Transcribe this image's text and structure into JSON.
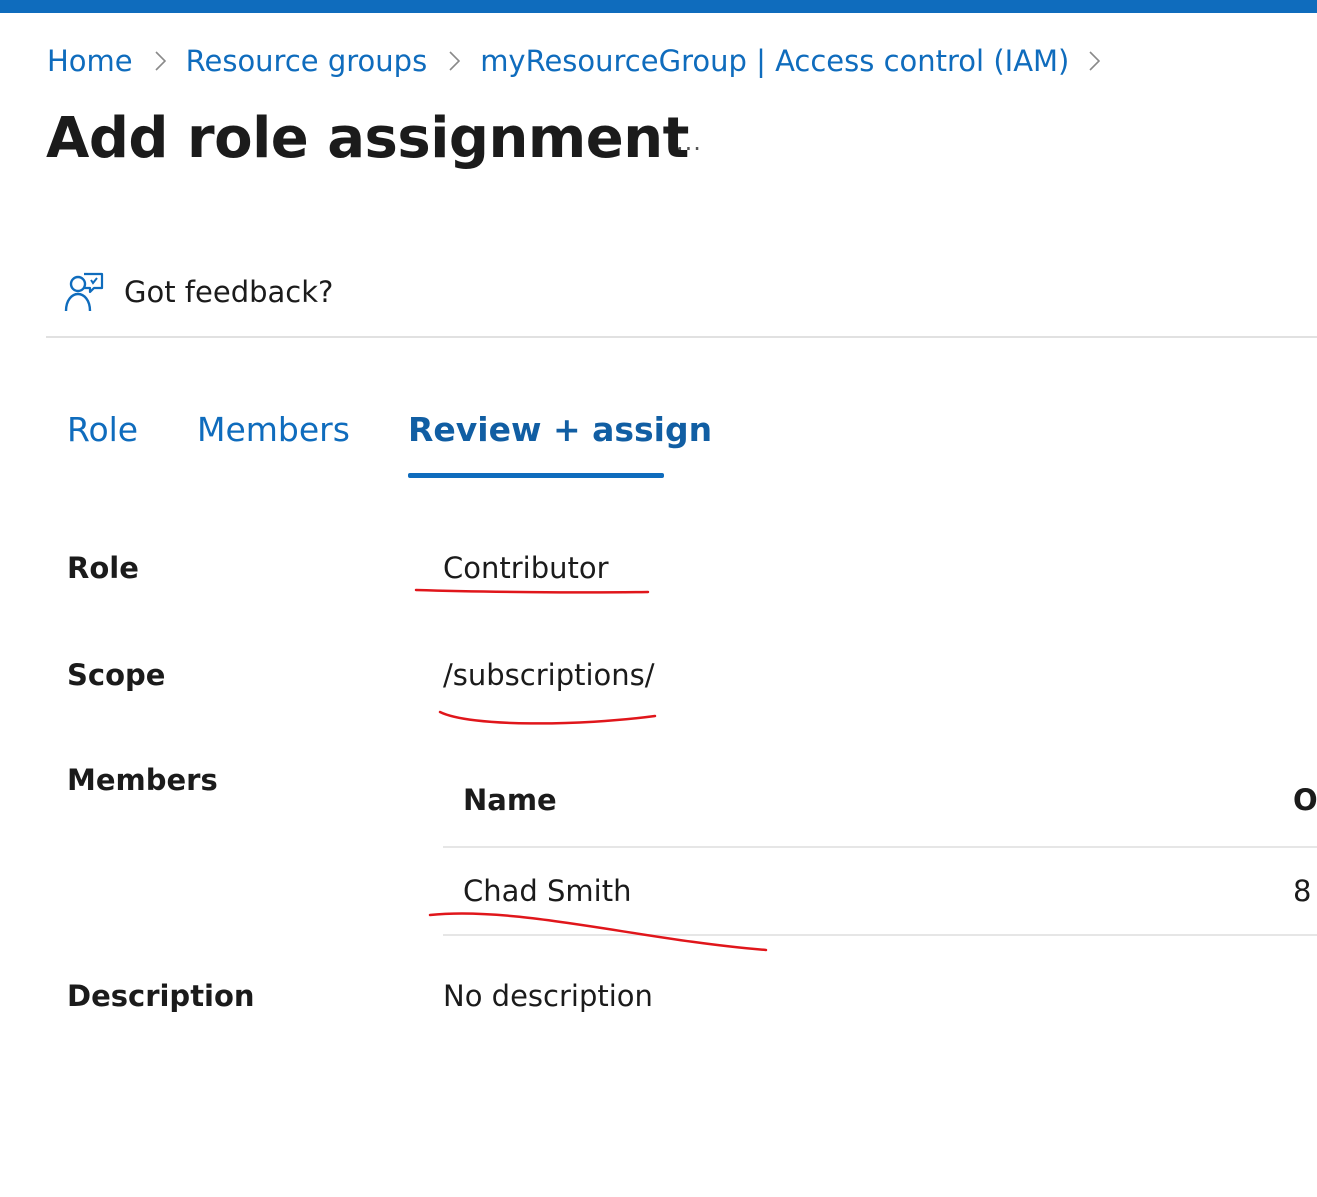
{
  "breadcrumb": {
    "items": [
      "Home",
      "Resource groups",
      "myResourceGroup | Access control (IAM)"
    ]
  },
  "page": {
    "title": "Add role assignment",
    "more_label": "..."
  },
  "toolbar": {
    "feedback_label": "Got feedback?"
  },
  "tabs": [
    {
      "label": "Role",
      "active": false
    },
    {
      "label": "Members",
      "active": false
    },
    {
      "label": "Review + assign",
      "active": true
    }
  ],
  "review": {
    "role_label": "Role",
    "role_value": "Contributor",
    "scope_label": "Scope",
    "scope_value": "/subscriptions/",
    "members_label": "Members",
    "members_table": {
      "columns": [
        "Name",
        "O"
      ],
      "rows": [
        [
          "Chad Smith",
          "8"
        ]
      ]
    },
    "description_label": "Description",
    "description_value": "No description"
  },
  "colors": {
    "accent": "#0f6cbd",
    "annotation": "#e0161b"
  }
}
